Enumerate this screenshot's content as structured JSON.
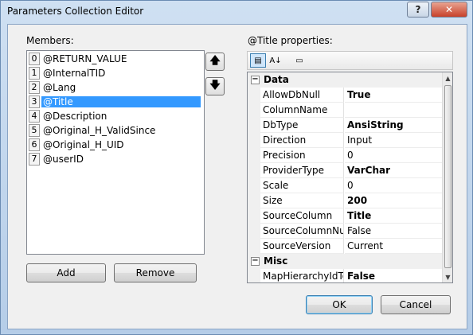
{
  "window": {
    "title": "Parameters Collection Editor",
    "help_label": "?",
    "close_label": "✕"
  },
  "members": {
    "label": "Members:",
    "items": [
      {
        "index": "0",
        "name": "@RETURN_VALUE"
      },
      {
        "index": "1",
        "name": "@InternalTID"
      },
      {
        "index": "2",
        "name": "@Lang"
      },
      {
        "index": "3",
        "name": "@Title"
      },
      {
        "index": "4",
        "name": "@Description"
      },
      {
        "index": "5",
        "name": "@Original_H_ValidSince"
      },
      {
        "index": "6",
        "name": "@Original_H_UID"
      },
      {
        "index": "7",
        "name": "@userID"
      }
    ],
    "selected_index": 3,
    "move_up_icon": "arrow-up-icon",
    "move_down_icon": "arrow-down-icon",
    "add_label": "Add",
    "remove_label": "Remove"
  },
  "properties": {
    "label": "@Title properties:",
    "toolbar": {
      "categorized_icon": "categorized-icon",
      "alphabetical_icon": "alphabetical-icon",
      "property_pages_icon": "property-pages-icon"
    },
    "categories": [
      {
        "name": "Data",
        "rows": [
          {
            "name": "AllowDbNull",
            "value": "True",
            "bold": true
          },
          {
            "name": "ColumnName",
            "value": "",
            "bold": false
          },
          {
            "name": "DbType",
            "value": "AnsiString",
            "bold": true
          },
          {
            "name": "Direction",
            "value": "Input",
            "bold": false
          },
          {
            "name": "Precision",
            "value": "0",
            "bold": false
          },
          {
            "name": "ProviderType",
            "value": "VarChar",
            "bold": true
          },
          {
            "name": "Scale",
            "value": "0",
            "bold": false
          },
          {
            "name": "Size",
            "value": "200",
            "bold": true
          },
          {
            "name": "SourceColumn",
            "value": "Title",
            "bold": true
          },
          {
            "name": "SourceColumnNull",
            "value": "False",
            "bold": false
          },
          {
            "name": "SourceVersion",
            "value": "Current",
            "bold": false
          }
        ]
      },
      {
        "name": "Misc",
        "rows": [
          {
            "name": "MapHierarchyIdToS",
            "value": "False",
            "bold": true
          }
        ]
      }
    ]
  },
  "buttons": {
    "ok_label": "OK",
    "cancel_label": "Cancel"
  }
}
